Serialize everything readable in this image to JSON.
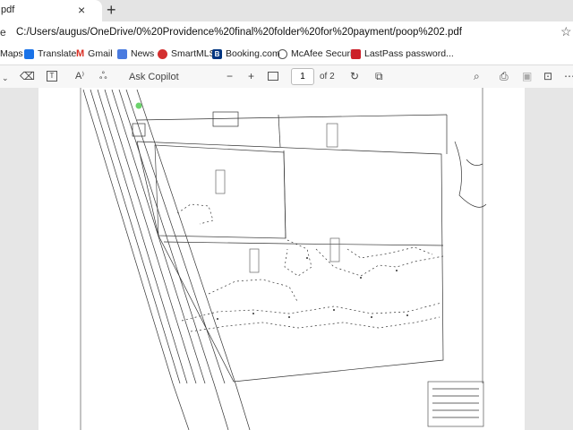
{
  "tab": {
    "title": "pdf",
    "close": "×",
    "new_tab": "+"
  },
  "address": {
    "url": "C:/Users/augus/OneDrive/0%20Providence%20final%20folder%20for%20payment/poop%202.pdf",
    "info_icon": "e",
    "star": "☆"
  },
  "favorites": [
    {
      "label": "Maps",
      "icon": "maps-icon",
      "color": ""
    },
    {
      "label": "Translate",
      "icon": "translate-icon",
      "color": "#1a73e8"
    },
    {
      "label": "Gmail",
      "icon": "gmail-icon",
      "color": "#d93025"
    },
    {
      "label": "News",
      "icon": "news-icon",
      "color": "#0b57d0"
    },
    {
      "label": "SmartMLS",
      "icon": "smartmls-icon",
      "color": "#d32f2f"
    },
    {
      "label": "Booking.com",
      "icon": "booking-icon",
      "color": "#003580"
    },
    {
      "label": "McAfee Security",
      "icon": "globe-icon",
      "color": "#555555"
    },
    {
      "label": "LastPass password...",
      "icon": "lastpass-icon",
      "color": "#cc2029"
    }
  ],
  "pdf_toolbar": {
    "ask_copilot": "Ask Copilot",
    "page_current": "1",
    "page_total": "of 2",
    "zoom_out": "−",
    "zoom_in": "+"
  }
}
